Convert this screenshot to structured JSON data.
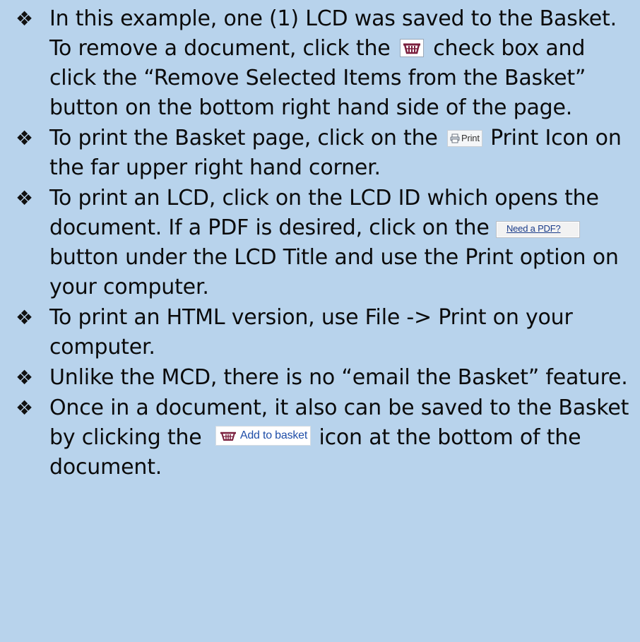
{
  "bullet_symbol": "❖",
  "items": [
    {
      "text_a": "In this example, one (1) LCD was saved to the Basket.  To remove a document, click the",
      "text_b": "check box and click the “Remove Selected Items from the Basket” button on the bottom right hand side of the page."
    },
    {
      "text_a": "To print the Basket page, click on the",
      "print_label": "Print",
      "text_b": "Print Icon on the far upper right hand corner."
    },
    {
      "text_a": "To print an LCD, click on the LCD ID which opens the document.  If a PDF is desired, click on the",
      "pdf_button_label": "Need a PDF?",
      "text_b": "button under the LCD Title and use the Print option on your computer."
    },
    {
      "text": "To print an HTML version, use File -> Print on your computer."
    },
    {
      "text": "Unlike the MCD, there is no “email the Basket” feature."
    },
    {
      "text_a": "Once in a document, it also can be saved to the Basket by clicking the",
      "add_basket_label": "Add to basket",
      "text_b": "icon at the bottom of the document."
    }
  ],
  "colors": {
    "background": "#b8d3ec",
    "text": "#0b0b0b",
    "basket_icon": "#7a1f3d",
    "link_blue": "#1f4ea8"
  },
  "icons": [
    "basket-icon",
    "print-icon",
    "bullet-diamond-icon"
  ]
}
